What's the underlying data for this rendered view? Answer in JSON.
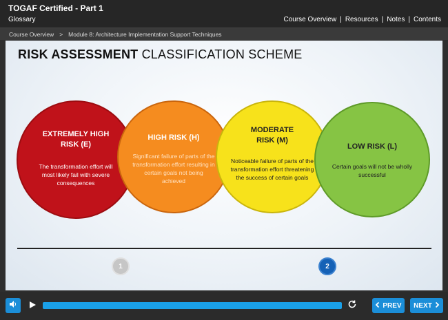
{
  "header": {
    "course_title": "TOGAF Certified - Part 1",
    "glossary_label": "Glossary",
    "nav": [
      "Course Overview",
      "Resources",
      "Notes",
      "Contents"
    ],
    "separator": "|"
  },
  "breadcrumb": {
    "items": [
      "Course Overview",
      "Module 8: Architecture Implementation Support Techniques"
    ],
    "separator": ">"
  },
  "slide": {
    "title_bold": "RISK ASSESSMENT",
    "title_rest": " CLASSIFICATION SCHEME",
    "risks": [
      {
        "title": "EXTREMELY HIGH RISK (E)",
        "description": "The transformation effort will most likely fail with severe consequences",
        "color": "#c0121a"
      },
      {
        "title": "HIGH RISK (H)",
        "description": "Significant failure of parts of the transformation effort resulting in certain goals not being achieved",
        "color": "#f58c1f"
      },
      {
        "title": "MODERATE RISK (M)",
        "description": "Noticeable failure of parts of the transformation effort threatening the success of certain goals",
        "color": "#f7e21b"
      },
      {
        "title": "LOW RISK (L)",
        "description": "Certain goals will not be wholly successful",
        "color": "#86c444"
      }
    ],
    "pages": [
      "1",
      "2"
    ],
    "current_page": "2"
  },
  "player": {
    "volume_icon": "speaker-icon",
    "play_icon": "play-icon",
    "replay_icon": "replay-icon",
    "progress": 1.0,
    "prev_label": "PREV",
    "next_label": "NEXT",
    "accent_color": "#1b8ed8"
  }
}
